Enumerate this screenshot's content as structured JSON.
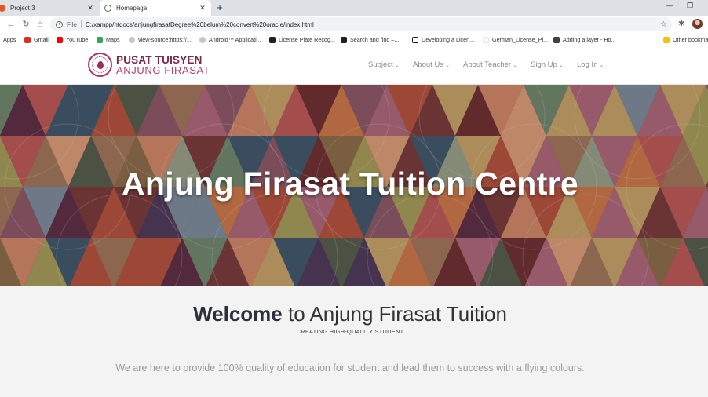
{
  "browser": {
    "tabs": [
      {
        "title": "Project 3",
        "close": "✕"
      },
      {
        "title": "Homepage",
        "close": "✕"
      }
    ],
    "new_tab": "+",
    "window_controls": {
      "minimize": "—",
      "restore": "❐"
    },
    "nav": {
      "back": "←",
      "forward": "→",
      "reload": "↻",
      "home": "⌂"
    },
    "address": {
      "info": "i",
      "scheme_label": "File",
      "url": "C:/xampp/htdocs/anjungfirasatDegree%20belum%20convert%20oracle/index.html",
      "star": "☆"
    },
    "extensions_icon": "✱",
    "bookmarks": [
      {
        "label": "Apps",
        "icon": "apps-grid-icon",
        "color": "#5f6368"
      },
      {
        "label": "Gmail",
        "icon": "gmail-icon",
        "color": "#d93025"
      },
      {
        "label": "YouTube",
        "icon": "youtube-icon",
        "color": "#ff0000"
      },
      {
        "label": "Maps",
        "icon": "maps-icon",
        "color": "#34a853"
      },
      {
        "label": "view-source:https://...",
        "icon": "globe-icon",
        "color": "#9aa0a6"
      },
      {
        "label": "Android™ Applicati...",
        "icon": "globe-icon",
        "color": "#9aa0a6"
      },
      {
        "label": "License Plate Recog...",
        "icon": "site-icon",
        "color": "#202124"
      },
      {
        "label": "Search and find –...",
        "icon": "site-icon",
        "color": "#202124"
      },
      {
        "label": "Developing a Licen...",
        "icon": "site-s-icon",
        "color": "#202124"
      },
      {
        "label": "German_License_Pl...",
        "icon": "globe-icon",
        "color": "#dadce0"
      },
      {
        "label": "Adding a layer - Ho...",
        "icon": "site-icon",
        "color": "#3c4043"
      },
      {
        "label": "Other bookma",
        "icon": "folder-icon",
        "color": "#f4c20d"
      }
    ]
  },
  "site": {
    "logo": {
      "line1": "PUSAT TUISYEN",
      "line2": "ANJUNG FIRASAT",
      "accent": "#9c2f54"
    },
    "menu": [
      {
        "label": "Subject"
      },
      {
        "label": "About Us"
      },
      {
        "label": "About Teacher"
      },
      {
        "label": "Sign Up"
      },
      {
        "label": "Log In"
      }
    ],
    "hero": {
      "title": "Anjung Firasat Tuition Centre"
    },
    "welcome": {
      "bold": "Welcome",
      "rest": " to Anjung Firasat Tuition"
    },
    "tagline": "CREATING HIGH-QUALITY STUDENT",
    "mission": "We are here to provide 100% quality of education for student and lead them to success with a flying colours."
  }
}
